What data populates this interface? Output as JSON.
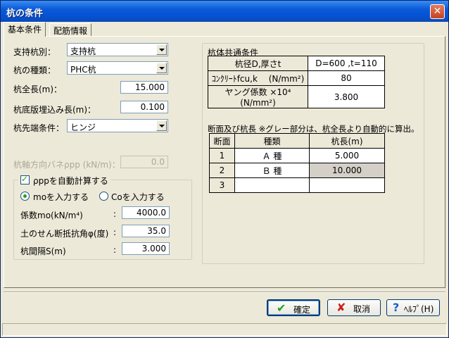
{
  "window": {
    "title": "杭の条件",
    "close_glyph": "✕"
  },
  "tabs": [
    {
      "label": "基本条件"
    },
    {
      "label": "配筋情報"
    }
  ],
  "left": {
    "support_type": {
      "label": "支持杭別：",
      "value": "支持杭"
    },
    "pile_type": {
      "label": "杭の種類：",
      "value": "PHC杭"
    },
    "pile_length": {
      "label": "杭全長(m)：",
      "value": "15.000"
    },
    "bottom_embed": {
      "label": "杭底版埋込み長(m)：",
      "value": "0.100"
    },
    "tip_condition": {
      "label": "杭先端条件：",
      "value": "ヒンジ"
    },
    "axial_spring": {
      "label": "杭軸方向バネρpp (kN/m)：",
      "value": "0.0"
    },
    "auto_calc": {
      "label": "ρppを自動計算する",
      "radio_mo": "moを入力する",
      "radio_co": "Coを入力する",
      "coef": {
        "label": "係数mo(kN/m⁴)",
        "colon": ":",
        "value": "4000.0"
      },
      "friction": {
        "label": "土のせん断抵抗角φ(度)",
        "colon": ":",
        "value": "35.0"
      },
      "spacing": {
        "label": "杭間隔S(m)",
        "colon": ":",
        "value": "3.000"
      }
    }
  },
  "right": {
    "common_title": "杭体共通条件",
    "common_rows": [
      {
        "label": "杭径D,厚さt",
        "value": "D=600 ,t=110"
      },
      {
        "label": "ｺﾝｸﾘｰﾄfcu,k　 (N/mm²)",
        "value": "80"
      },
      {
        "label": "ヤング係数 ×10⁴ (N/mm²)",
        "value": "3.800"
      }
    ],
    "section_title": "断面及び杭長 ※グレー部分は、杭全長より自動的に算出。",
    "section_headers": {
      "col1": "断面",
      "col2": "種類",
      "col3": "杭長(m)"
    },
    "section_rows": [
      {
        "no": "1",
        "kind": "Ａ 種",
        "length": "5.000"
      },
      {
        "no": "2",
        "kind": "Ｂ 種",
        "length": "10.000"
      },
      {
        "no": "3",
        "kind": "",
        "length": ""
      }
    ]
  },
  "buttons": {
    "ok": {
      "label": "確定",
      "icon": "✔"
    },
    "cancel": {
      "label": "取消",
      "icon": "✘"
    },
    "help": {
      "label": "ﾍﾙﾌﾟ(H)",
      "icon": "?"
    }
  }
}
